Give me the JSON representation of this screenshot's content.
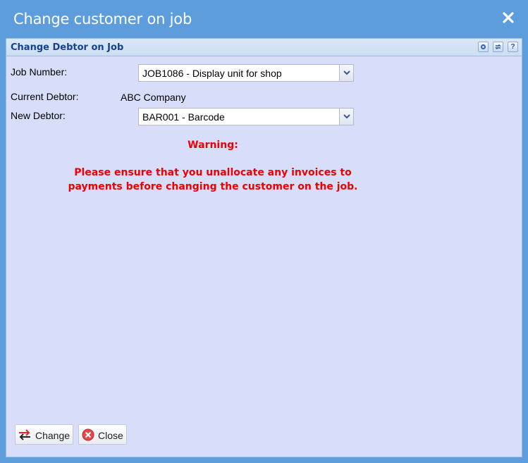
{
  "window": {
    "title": "Change customer on job"
  },
  "panel": {
    "title": "Change Debtor on Job"
  },
  "form": {
    "job_number_label": "Job Number:",
    "job_number_value": "JOB1086 - Display unit for shop",
    "current_debtor_label": "Current Debtor:",
    "current_debtor_value": "ABC Company",
    "new_debtor_label": "New Debtor:",
    "new_debtor_value": "BAR001 - Barcode"
  },
  "warning": {
    "heading": "Warning:",
    "line1": "Please ensure that you unallocate any invoices to",
    "line2": "payments before changing the customer on the job."
  },
  "buttons": {
    "change_label": "Change",
    "close_label": "Close"
  },
  "icons": {
    "window_close": "close-icon",
    "tool_gear": "gear-icon",
    "tool_refresh": "refresh-icon",
    "tool_help": "help-icon",
    "change": "swap-arrows-icon",
    "close": "close-circle-icon"
  },
  "colors": {
    "accent": "#5e9ddc",
    "panel_bg": "#d8defa",
    "warning": "#ee0000",
    "panel_title": "#15428b"
  }
}
